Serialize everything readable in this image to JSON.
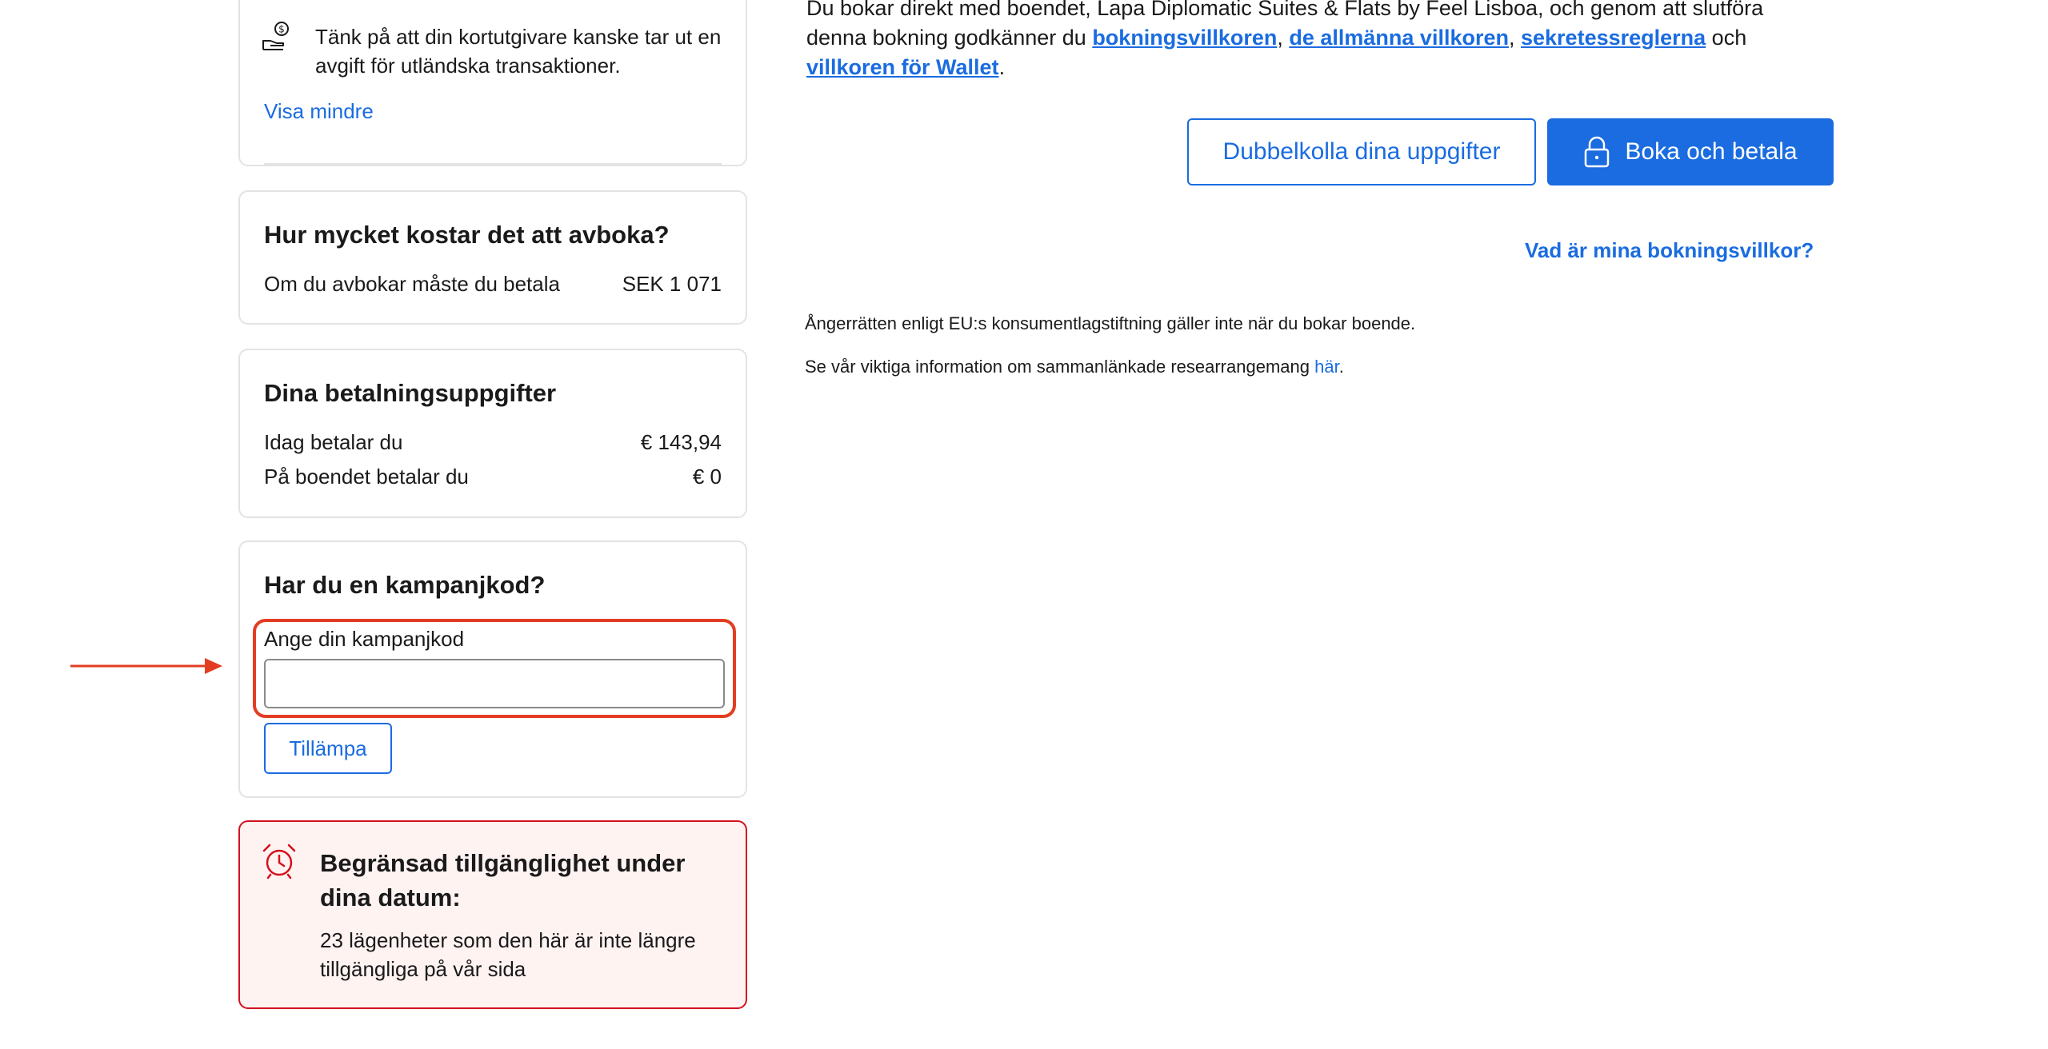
{
  "fees_card": {
    "text": "Tänk på att din kortutgivare kanske tar ut en avgift för utländska transaktioner.",
    "show_less": "Visa mindre",
    "icon": "hand-coin-icon"
  },
  "cancellation_card": {
    "title": "Hur mycket kostar det att avboka?",
    "label": "Om du avbokar måste du betala",
    "value": "SEK 1 071"
  },
  "payment_card": {
    "title": "Dina betalningsuppgifter",
    "rows": [
      {
        "label": "Idag betalar du",
        "value": "€ 143,94"
      },
      {
        "label": "På boendet betalar du",
        "value": "€ 0"
      }
    ]
  },
  "promo_card": {
    "title": "Har du en kampanjkod?",
    "input_label": "Ange din kampanjkod",
    "input_value": "",
    "apply_label": "Tillämpa"
  },
  "availability_card": {
    "title": "Begränsad tillgänglighet under dina datum:",
    "text": "23 lägenheter som den här är inte längre tillgängliga på vår sida",
    "icon": "alarm-clock-icon"
  },
  "terms": {
    "intro": "Du bokar direkt med boendet, Lapa Diplomatic Suites & Flats by Feel Lisboa, och genom att slutföra denna bokning godkänner du ",
    "link1": "bokningsvillkoren",
    "sep1": ", ",
    "link2": "de allmänna villkoren",
    "sep2": ", ",
    "link3": "sekretessreglerna",
    "sep3": " och ",
    "link4": "villkoren för Wallet",
    "end": "."
  },
  "actions": {
    "double_check_label": "Dubbelkolla dina uppgifter",
    "book_pay_label": "Boka och betala",
    "booking_terms_link": "Vad är mina bokningsvillkor?"
  },
  "notes": {
    "withdrawal": "Ångerrätten enligt EU:s konsumentlagstiftning gäller inte när du bokar boende.",
    "travel_prefix": "Se vår viktiga information om sammanlänkade researrangemang ",
    "travel_link": "här",
    "travel_suffix": "."
  },
  "colors": {
    "accent": "#1a6ce0",
    "highlight": "#e23d22",
    "alert_border": "#d4111e",
    "alert_bg": "#fff3f2"
  }
}
